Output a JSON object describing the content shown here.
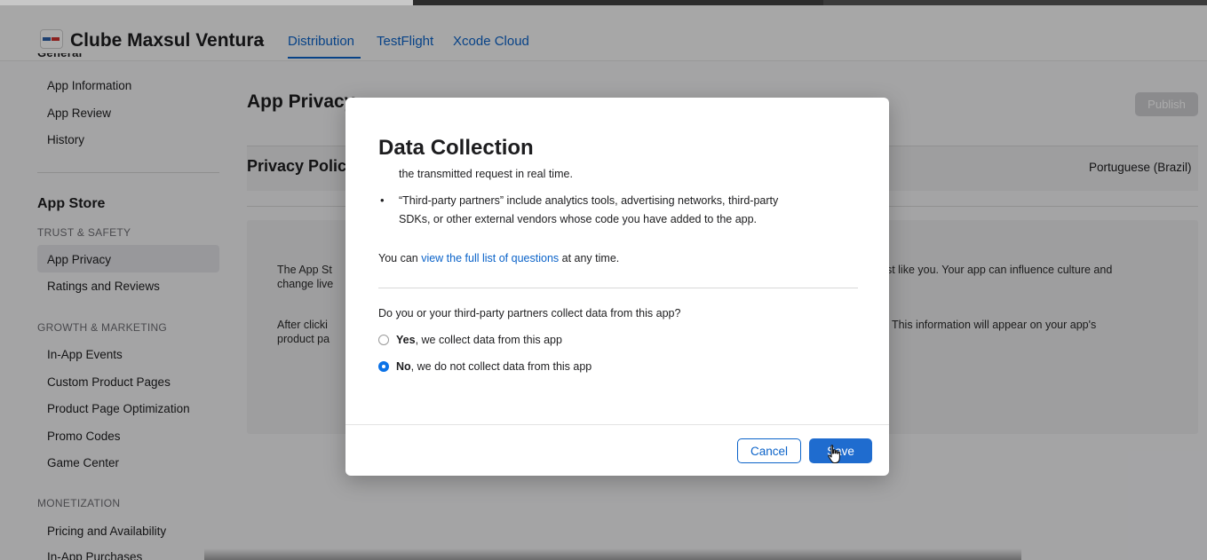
{
  "header": {
    "app_name": "Clube Maxsul Ventura",
    "app_switcher_icon": "chevron-down-icon",
    "tabs": [
      "Distribution",
      "TestFlight",
      "Xcode Cloud"
    ],
    "active_tab": "Distribution"
  },
  "sidebar": {
    "general_heading": "General",
    "general_items": [
      "App Information",
      "App Review",
      "History"
    ],
    "store_heading": "App Store",
    "sections": [
      {
        "title": "TRUST & SAFETY",
        "items": [
          "App Privacy",
          "Ratings and Reviews"
        ]
      },
      {
        "title": "GROWTH & MARKETING",
        "items": [
          "In-App Events",
          "Custom Product Pages",
          "Product Page Optimization",
          "Promo Codes",
          "Game Center"
        ]
      },
      {
        "title": "MONETIZATION",
        "items": [
          "Pricing and Availability",
          "In-App Purchases"
        ]
      }
    ],
    "active_item": "App Privacy"
  },
  "main": {
    "page_title": "App Privacy",
    "publish_label": "Publish",
    "privacy_policy_title": "Privacy Policy",
    "privacy_policy_language": "Portuguese (Brazil)",
    "info_line1_left": "The App St",
    "info_line1_right": "ust like you. Your app can influence culture and",
    "info_line2_left": "change live",
    "info_line3_left": "After clicki",
    "info_line3_right": "s. This information will appear on your app's",
    "info_line4_left": "product pa"
  },
  "modal": {
    "title": "Data Collection",
    "text_top": "the transmitted request in real time.",
    "bullet": "•",
    "bullet_line1": "“Third-party partners” include analytics tools, advertising networks, third-party",
    "bullet_line2": "SDKs, or other external vendors whose code you have added to the app.",
    "view_prefix": "You can ",
    "view_link": "view the full list of questions",
    "view_suffix": " at any time.",
    "question": "Do you or your third-party partners collect data from this app?",
    "option_yes_bold": "Yes",
    "option_yes_rest": ", we collect data from this app",
    "option_no_bold": "No",
    "option_no_rest": ", we do not collect data from this app",
    "selected_option": "No",
    "cancel_label": "Cancel",
    "save_label": "Save"
  },
  "colors": {
    "accent": "#0b63c9",
    "primary_button": "#1f6ccf",
    "radio_selected": "#0b72e7"
  }
}
